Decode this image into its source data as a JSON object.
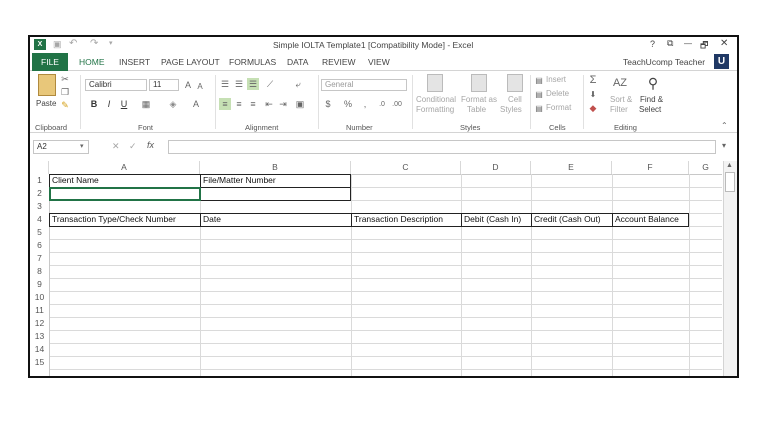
{
  "titlebar": {
    "title": "Simple IOLTA Template1  [Compatibility Mode] - Excel",
    "help": "?",
    "restore": "⧉",
    "minimize": "—",
    "maximize": "🗗",
    "close": "✕"
  },
  "tabs": {
    "file": "FILE",
    "items": [
      "HOME",
      "INSERT",
      "PAGE LAYOUT",
      "FORMULAS",
      "DATA",
      "REVIEW",
      "VIEW"
    ],
    "user": "TeachUcomp Teacher",
    "user_badge": "U"
  },
  "ribbon": {
    "paste": "Paste",
    "clipboard": "Clipboard",
    "font_name": "Calibri",
    "font_size": "11",
    "font_group": "Font",
    "bold": "B",
    "italic": "I",
    "underline": "U",
    "alignment": "Alignment",
    "number_format": "General",
    "currency": "$",
    "percent": "%",
    "comma": ",",
    "number_group": "Number",
    "conditional": "Conditional",
    "formatting": "Formatting",
    "format_as": "Format as",
    "table": "Table",
    "cell": "Cell",
    "styles_btn": "Styles",
    "styles_group": "Styles",
    "insert": "Insert",
    "delete": "Delete",
    "format": "Format",
    "cells_group": "Cells",
    "sort": "Sort &",
    "filter": "Filter",
    "find": "Find &",
    "select": "Select",
    "editing_group": "Editing"
  },
  "formula_bar": {
    "name_box": "A2",
    "fx": "fx",
    "cancel": "✕",
    "enter": "✓"
  },
  "sheet": {
    "columns": [
      "A",
      "B",
      "C",
      "D",
      "E",
      "F",
      "G"
    ],
    "rows": [
      "1",
      "2",
      "3",
      "4",
      "5",
      "6",
      "7",
      "8",
      "9",
      "10",
      "11",
      "12",
      "13",
      "14",
      "15"
    ],
    "cells": {
      "a1": "Client Name",
      "b1": "File/Matter Number",
      "a4": "Transaction Type/Check Number",
      "b4": "Date",
      "c4": "Transaction Description",
      "d4": "Debit (Cash In)",
      "e4": "Credit (Cash Out)",
      "f4": "Account Balance"
    }
  },
  "colors": {
    "excel_green": "#217346",
    "user_badge": "#1f3864"
  }
}
